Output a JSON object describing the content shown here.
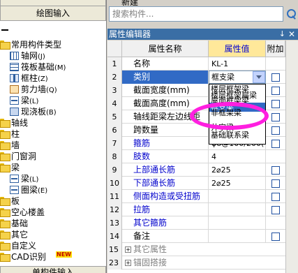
{
  "left_panel": {
    "top_buttons": [
      "",
      "绘图输入"
    ],
    "tree": [
      {
        "label": "常用构件类型",
        "level": 0,
        "icon": "folder-icon"
      },
      {
        "label": "轴网",
        "sub": "(J)",
        "level": 1,
        "icon": "grid-icon"
      },
      {
        "label": "筏板基础",
        "sub": "(M)",
        "level": 1,
        "icon": "foundation-icon"
      },
      {
        "label": "框柱",
        "sub": "(Z)",
        "level": 1,
        "icon": "column-icon"
      },
      {
        "label": "剪力墙",
        "sub": "(Q)",
        "level": 1,
        "icon": "wall-icon"
      },
      {
        "label": "梁",
        "sub": "(L)",
        "level": 1,
        "icon": "beam-icon"
      },
      {
        "label": "现浇板",
        "sub": "(B)",
        "level": 1,
        "icon": "slab-icon"
      },
      {
        "label": "轴线",
        "level": 0,
        "icon": "folder-icon"
      },
      {
        "label": "柱",
        "level": 0,
        "icon": "folder-icon"
      },
      {
        "label": "墙",
        "level": 0,
        "icon": "folder-icon"
      },
      {
        "label": "门窗洞",
        "level": 0,
        "icon": "folder-icon"
      },
      {
        "label": "梁",
        "level": 0,
        "icon": "folder-icon"
      },
      {
        "label": "梁",
        "sub": "(L)",
        "level": 1,
        "icon": "beam-icon"
      },
      {
        "label": "圈梁",
        "sub": "(E)",
        "level": 1,
        "icon": "ring-beam-icon"
      },
      {
        "label": "板",
        "level": 0,
        "icon": "folder-icon"
      },
      {
        "label": "空心楼盖",
        "level": 0,
        "icon": "folder-icon"
      },
      {
        "label": "基础",
        "level": 0,
        "icon": "folder-icon"
      },
      {
        "label": "其它",
        "level": 0,
        "icon": "folder-icon"
      },
      {
        "label": "自定义",
        "level": 0,
        "icon": "folder-icon"
      },
      {
        "label": "CAD识别",
        "level": 0,
        "icon": "folder-icon",
        "badge": "NEW"
      }
    ],
    "bottom_button": "单构件输入"
  },
  "toolbar": {
    "new_label": "新建"
  },
  "search": {
    "placeholder": "搜索构件..."
  },
  "prop_panel": {
    "title": "属性编辑器",
    "pin_icon": "pin-icon",
    "close_icon": "close-icon",
    "headers": {
      "num": "",
      "name": "属性名称",
      "value": "属性值",
      "extra": "附加"
    },
    "rows": [
      {
        "num": "1",
        "name": "名称",
        "value": "KL-1",
        "color": "black",
        "checkbox": false
      },
      {
        "num": "2",
        "name": "类别",
        "value": "框支梁",
        "color": "blue",
        "checkbox": true,
        "selected": true
      },
      {
        "num": "3",
        "name": "截面宽度(mm)",
        "value": "",
        "color": "black",
        "checkbox": true
      },
      {
        "num": "4",
        "name": "截面高度(mm)",
        "value": "",
        "color": "black",
        "checkbox": true
      },
      {
        "num": "5",
        "name": "轴线距梁左边线距",
        "value": "",
        "color": "black",
        "checkbox": true
      },
      {
        "num": "6",
        "name": "跨数量",
        "value": "",
        "color": "black",
        "checkbox": true
      },
      {
        "num": "7",
        "name": "箍筋",
        "value": "φ8@100/200(",
        "color": "blue",
        "checkbox": true
      },
      {
        "num": "8",
        "name": "肢数",
        "value": "4",
        "color": "blue",
        "checkbox": false
      },
      {
        "num": "9",
        "name": "上部通长筋",
        "value": "2⌀25",
        "color": "blue",
        "checkbox": true
      },
      {
        "num": "10",
        "name": "下部通长筋",
        "value": "2⌀25",
        "color": "blue",
        "checkbox": true
      },
      {
        "num": "11",
        "name": "侧面构造或受扭筋",
        "value": "",
        "color": "blue",
        "checkbox": true
      },
      {
        "num": "12",
        "name": "拉筋",
        "value": "",
        "color": "blue",
        "checkbox": true
      },
      {
        "num": "13",
        "name": "其它箍筋",
        "value": "",
        "color": "blue",
        "checkbox": false
      },
      {
        "num": "14",
        "name": "备注",
        "value": "",
        "color": "black",
        "checkbox": true
      }
    ],
    "groups": [
      {
        "num": "15",
        "name": "其它属性"
      },
      {
        "num": "23",
        "name": "锚固搭接"
      }
    ],
    "dropdown": {
      "value": "框支梁",
      "options": [
        "楼层框架梁",
        "楼层框架扁梁",
        "屋面框架梁",
        "框支梁",
        "非框架梁",
        "井字梁",
        "基础联系梁"
      ],
      "highlighted_index": 3
    }
  }
}
